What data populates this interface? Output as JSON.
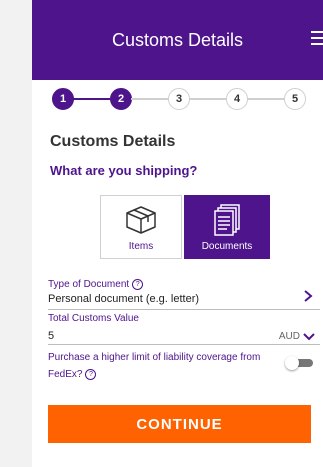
{
  "header": {
    "title": "Customs Details"
  },
  "steps": [
    "1",
    "2",
    "3",
    "4",
    "5"
  ],
  "section": {
    "title": "Customs Details",
    "subtitle": "What are you shipping?"
  },
  "shipment_types": {
    "items_label": "Items",
    "documents_label": "Documents",
    "selected": "Documents"
  },
  "document_type": {
    "label": "Type of Document",
    "value": "Personal document (e.g. letter)"
  },
  "customs_value": {
    "label": "Total Customs Value",
    "value": "5",
    "currency": "AUD"
  },
  "liability": {
    "text": "Purchase a higher limit of liability coverage from FedEx?",
    "enabled": false
  },
  "continue_label": "CONTINUE",
  "colors": {
    "brand_purple": "#4d148c",
    "accent_orange": "#ff6200"
  },
  "icons": {
    "menu": "hamburger-icon",
    "items": "box-icon",
    "documents": "documents-icon",
    "help": "question-circle-icon"
  }
}
